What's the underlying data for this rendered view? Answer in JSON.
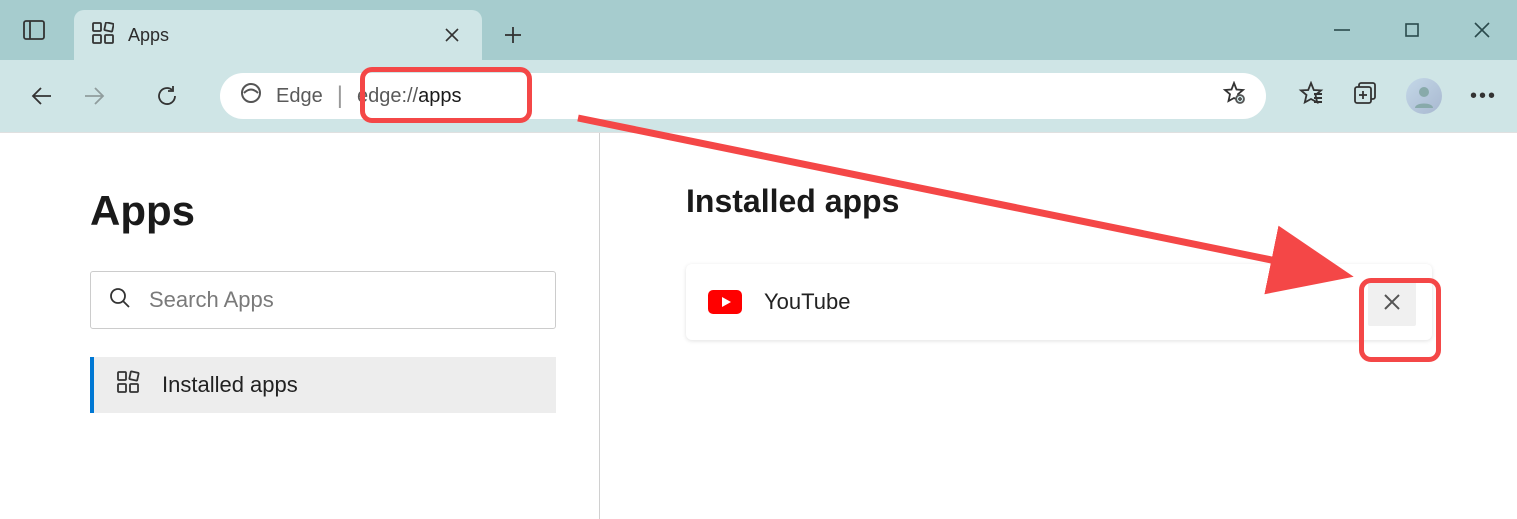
{
  "tab": {
    "title": "Apps"
  },
  "address": {
    "label": "Edge",
    "url_prefix": "edge://",
    "url_path": "apps"
  },
  "sidebar": {
    "title": "Apps",
    "search_placeholder": "Search Apps",
    "nav_item": "Installed apps"
  },
  "main": {
    "heading": "Installed apps",
    "app_name": "YouTube"
  }
}
